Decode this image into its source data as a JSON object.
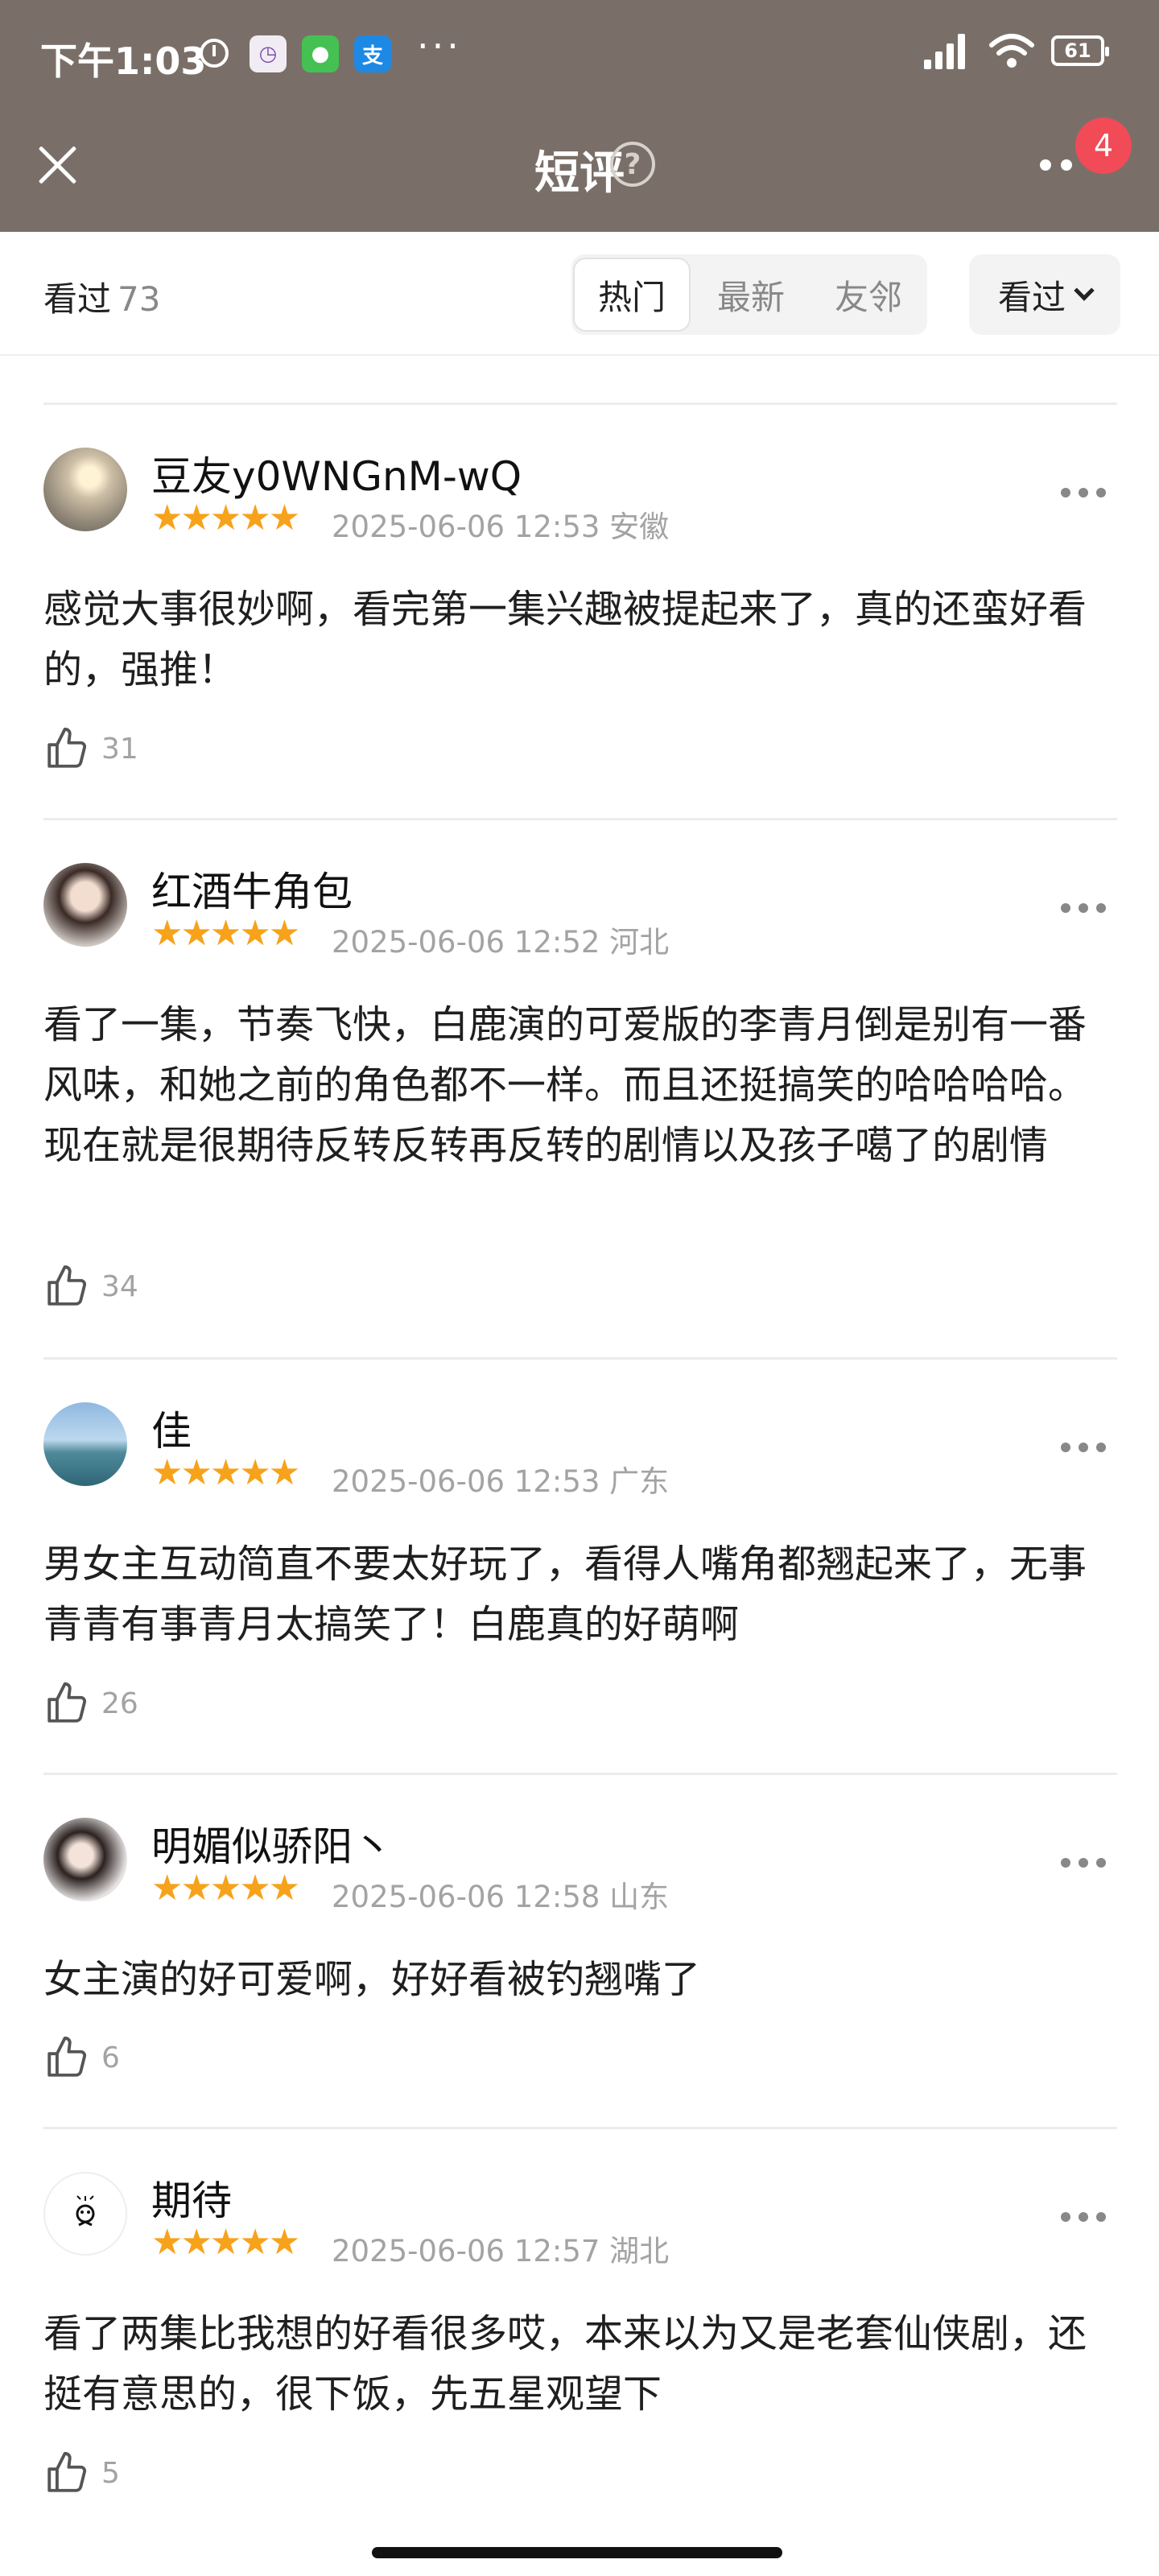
{
  "status_bar": {
    "time": "下午1:03",
    "apps": [
      "clock-app",
      "wechat-app",
      "alipay-app"
    ],
    "battery": "61"
  },
  "header": {
    "title": "短评",
    "help_icon": "?",
    "notification_count": "4"
  },
  "filter_bar": {
    "count_label": "看过",
    "count_value": "73",
    "tabs": [
      {
        "label": "热门",
        "active": true
      },
      {
        "label": "最新",
        "active": false
      },
      {
        "label": "友邻",
        "active": false
      }
    ],
    "status_filter": "看过"
  },
  "colors": {
    "header_bg": "#7a6f68",
    "star": "#f7a21b",
    "badge": "#f04b57"
  },
  "reviews": [
    {
      "username": "豆友y0WNGnM-wQ",
      "stars": "★★★★★",
      "rating": 5,
      "meta": "2025-06-06 12:53 安徽",
      "text": "感觉大事很妙啊，看完第一集兴趣被提起来了，真的还蛮好看的，强推！",
      "likes": "31"
    },
    {
      "username": "红酒牛角包",
      "stars": "★★★★★",
      "rating": 5,
      "meta": "2025-06-06 12:52 河北",
      "text": "看了一集，节奏飞快，白鹿演的可爱版的李青月倒是别有一番风味，和她之前的角色都不一样。而且还挺搞笑的哈哈哈哈。现在就是很期待反转反转再反转的剧情以及孩子噶了的剧情",
      "likes": "34"
    },
    {
      "username": "佳",
      "stars": "★★★★★",
      "rating": 5,
      "meta": "2025-06-06 12:53 广东",
      "text": "男女主互动简直不要太好玩了，看得人嘴角都翘起来了，无事青青有事青月太搞笑了！白鹿真的好萌啊",
      "likes": "26"
    },
    {
      "username": "明媚似骄阳丶",
      "stars": "★★★★★",
      "rating": 5,
      "meta": "2025-06-06 12:58 山东",
      "text": "女主演的好可爱啊，好好看被钓翘嘴了",
      "likes": "6"
    },
    {
      "username": "期待",
      "stars": "★★★★★",
      "rating": 5,
      "meta": "2025-06-06 12:57 湖北",
      "text": "看了两集比我想的好看很多哎，本来以为又是老套仙侠剧，还挺有意思的，很下饭，先五星观望下",
      "likes": "5"
    }
  ]
}
